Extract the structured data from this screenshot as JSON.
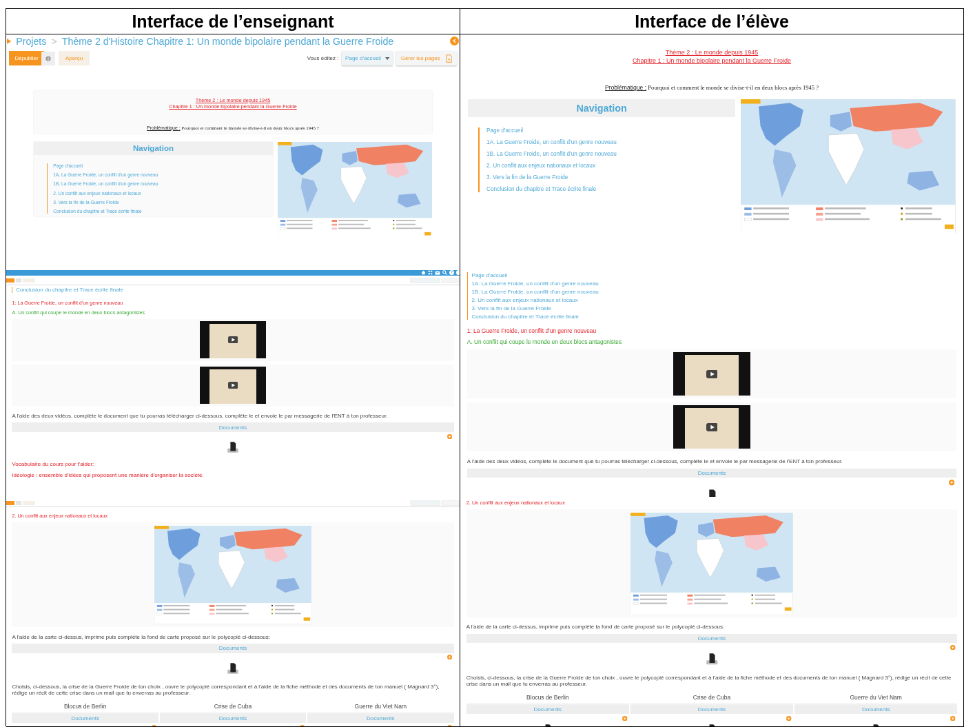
{
  "headers": [
    "Interface de l’enseignant",
    "Interface de l’élève"
  ],
  "rows": [
    {
      "cells": [
        {
          "blocks": [
            {
              "kind": "breadcrumb",
              "root": "Projets",
              "separator": ">",
              "title": "Thème 2 d'Histoire Chapitre 1: Un monde bipolaire pendant la Guerre Froide"
            },
            {
              "kind": "editor_toolbar",
              "publish": "Dépublier",
              "preview": "Aperçu",
              "editing_label": "Vous éditez :",
              "page": "Page d'accueil",
              "manage": "Gérer les pages"
            },
            {
              "kind": "title_card",
              "lines": [
                "Thème 2 : Le monde depuis 1945",
                "Chapitre 1 : Un monde bipolaire pendant la Guerre Froide"
              ],
              "problem_label": "Problématique :",
              "problem_text": "Pourquoi et comment le monde se divise-t-il en deux blocs après 1945 ?"
            },
            {
              "kind": "navigation_map",
              "heading": "Navigation",
              "items": [
                "Page d'accueil",
                "1A. La Guerre Froide, un conflit d'un genre nouveau",
                "1B. La Guerre Froide, un conflit d'un genre nouveau",
                "2. Un conflit aux enjeux nationaux et locaux",
                "3. Vers la fin de la Guerre Froide",
                "Conclusion du chapitre et Trace écrite finale"
              ]
            }
          ]
        },
        {
          "blocks": [
            {
              "kind": "title_card",
              "lines": [
                "Thème 2 : Le monde depuis 1945",
                "Chapitre 1 : Un monde bipolaire pendant la Guerre Froide"
              ],
              "problem_label": "Problématique :",
              "problem_text": "Pourquoi et comment le monde se divise-t-il en deux blocs après 1945 ?"
            },
            {
              "kind": "navigation_map",
              "heading": "Navigation",
              "items": [
                "Page d'accueil",
                "1A. La Guerre Froide, un conflit d'un genre nouveau",
                "1B. La Guerre Froide, un conflit d'un genre nouveau",
                "2. Un conflit aux enjeux nationaux et locaux",
                "3. Vers la fin de la Guerre Froide",
                "Conclusion du chapitre et Trace écrite finale"
              ]
            }
          ]
        }
      ]
    },
    {
      "cells": [
        {
          "blocks": [
            {
              "kind": "app_bar"
            },
            {
              "kind": "mini_toolbar"
            },
            {
              "kind": "nav_list",
              "items": [
                "Conclusion du chapitre et Trace écrite finale"
              ]
            },
            {
              "kind": "part_title",
              "text": "1: La Guerre Froide, un conflit d'un genre nouveau"
            },
            {
              "kind": "subpart_title",
              "text": "A. Un conflit qui coupe le monde en deux blocs antagonistes"
            },
            {
              "kind": "video"
            },
            {
              "kind": "video"
            },
            {
              "kind": "paragraph",
              "text": "A l'aide des deux vidéos, complète le document que tu pourras télécharger ci-dessous, complète le et envoie le par messagerie de l'ENT à ton professeur."
            },
            {
              "kind": "documents",
              "label": "Documents"
            },
            {
              "kind": "vocabulary",
              "lines": [
                "Vocabulaire du cours pour t'aider:",
                "Idéologie : ensemble d'idées qui proposent une manière d'organiser la société."
              ]
            }
          ]
        },
        {
          "blocks": [
            {
              "kind": "nav_list",
              "items": [
                "Page d'accueil",
                "1A. La Guerre Froide, un conflit d'un genre nouveau",
                "1B. La Guerre Froide, un conflit d'un genre nouveau",
                "2. Un conflit aux enjeux nationaux et locaux",
                "3. Vers la fin de la Guerre Froide",
                "Conclusion du chapitre et Trace écrite finale"
              ]
            },
            {
              "kind": "part_title",
              "text": "1: La Guerre Froide, un conflit d'un genre nouveau"
            },
            {
              "kind": "subpart_title",
              "text": "A. Un conflit qui coupe le monde en deux blocs antagonistes"
            },
            {
              "kind": "video"
            },
            {
              "kind": "video"
            },
            {
              "kind": "paragraph",
              "text": "A l'aide des deux vidéos, complète le document que tu pourras télécharger ci-dessous, complète le et envoie le par messagerie de l'ENT à ton professeur."
            },
            {
              "kind": "documents",
              "label": "Documents"
            }
          ]
        }
      ]
    },
    {
      "cells": [
        {
          "blocks": [
            {
              "kind": "mini_toolbar"
            },
            {
              "kind": "part_title",
              "text": "2. Un conflit aux enjeux nationaux et locaux"
            },
            {
              "kind": "map"
            },
            {
              "kind": "paragraph",
              "text": "A l'aide de la carte ci-dessus,  imprime puis complète la fond de carte proposé sur le polycopié ci-dessous:"
            },
            {
              "kind": "documents",
              "label": "Documents"
            },
            {
              "kind": "paragraph",
              "text": "Choisis, ci-dessous, la crise de la Guerre Froide de ton choix , ouvre le polycopié correspondant et à l'aide de la fiche méthode et des documents de ton manuel ( Magnard 3°),  rédige un récit de cette crise dans un mail que tu enverras au professeur."
            },
            {
              "kind": "choices",
              "items": [
                {
                  "label": "Blocus de Berlin",
                  "documents": "Documents"
                },
                {
                  "label": "Crise de Cuba",
                  "documents": "Documents"
                },
                {
                  "label": "Guerre du Viet Nam",
                  "documents": "Documents"
                }
              ]
            }
          ]
        },
        {
          "blocks": [
            {
              "kind": "part_title",
              "text": "2. Un conflit aux enjeux nationaux et locaux"
            },
            {
              "kind": "map"
            },
            {
              "kind": "paragraph",
              "text": "A l'aide de la carte ci-dessus,  imprime puis complète la fond de carte proposé sur le polycopié ci-dessous:"
            },
            {
              "kind": "documents",
              "label": "Documents"
            },
            {
              "kind": "paragraph",
              "text": "Choisis, ci-dessous, la crise de la Guerre Froide de ton choix , ouvre le polycopié correspondant et à l'aide de la fiche méthode et des documents de ton manuel ( Magnard 3°),  rédige un récit de cette crise dans un mail que tu enverras au professeur."
            },
            {
              "kind": "choices",
              "items": [
                {
                  "label": "Blocus de Berlin",
                  "documents": "Documents"
                },
                {
                  "label": "Crise de Cuba",
                  "documents": "Documents"
                },
                {
                  "label": "Guerre du Viet Nam",
                  "documents": "Documents"
                }
              ]
            }
          ]
        }
      ]
    }
  ]
}
